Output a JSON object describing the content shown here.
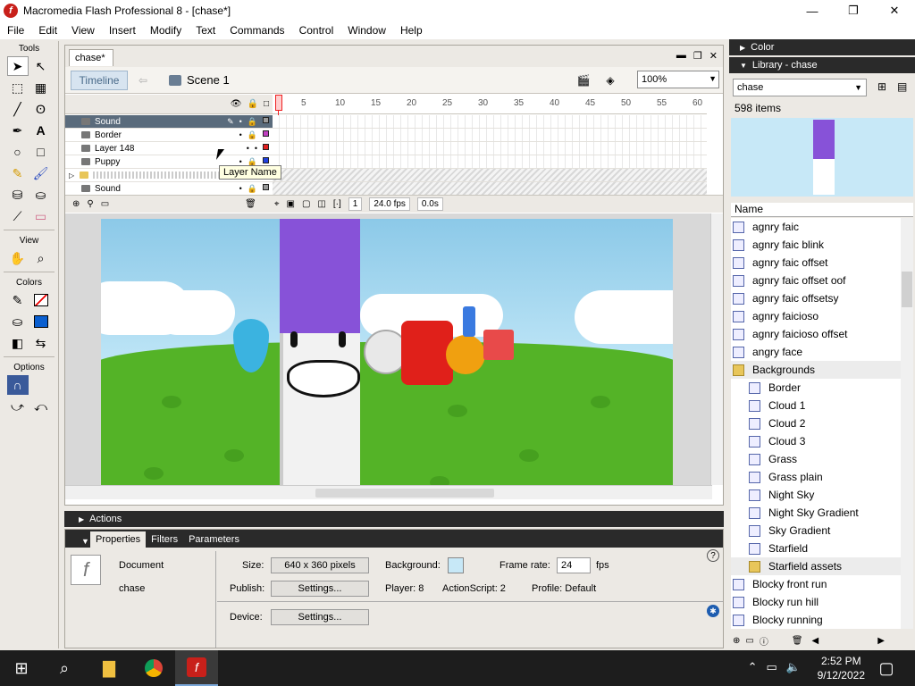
{
  "window": {
    "title": "Macromedia Flash Professional 8 - [chase*]",
    "minimize": "—",
    "maximize": "❐",
    "close": "✕"
  },
  "menu": [
    "File",
    "Edit",
    "View",
    "Insert",
    "Modify",
    "Text",
    "Commands",
    "Control",
    "Window",
    "Help"
  ],
  "tools": {
    "title": "Tools",
    "view_title": "View",
    "colors_title": "Colors",
    "options_title": "Options"
  },
  "document": {
    "tab": "chase*",
    "timeline_btn": "Timeline",
    "scene": "Scene 1",
    "zoom": "100%"
  },
  "timeline": {
    "ruler": [
      "5",
      "10",
      "15",
      "20",
      "25",
      "30",
      "35",
      "40",
      "45",
      "50",
      "55",
      "60"
    ],
    "layers": [
      {
        "name": "Sound",
        "selected": true
      },
      {
        "name": "Border",
        "selected": false
      },
      {
        "name": "Layer 148",
        "selected": false
      },
      {
        "name": "Puppy",
        "selected": false
      },
      {
        "name": "",
        "selected": false
      },
      {
        "name": "Sound",
        "selected": false
      }
    ],
    "current_frame": "1",
    "fps": "24.0 fps",
    "time": "0.0s",
    "tooltip": "Layer Name"
  },
  "actions": {
    "title": "Actions"
  },
  "properties": {
    "tabs": [
      "Properties",
      "Filters",
      "Parameters"
    ],
    "doc_label": "Document",
    "doc_name": "chase",
    "size_label": "Size:",
    "size_value": "640 x 360 pixels",
    "background_label": "Background:",
    "frame_rate_label": "Frame rate:",
    "frame_rate_value": "24",
    "fps_unit": "fps",
    "publish_label": "Publish:",
    "settings_label": "Settings...",
    "player_label": "Player: 8",
    "actionscript_label": "ActionScript:  2",
    "profile_label": "Profile:  Default",
    "device_label": "Device:",
    "device_settings": "Settings..."
  },
  "right_panels": {
    "color_title": "Color",
    "library_title": "Library - chase",
    "library_select": "chase",
    "item_count": "598 items",
    "col_name": "Name",
    "items": [
      {
        "name": "agnry faic",
        "type": "graphic",
        "indent": 0
      },
      {
        "name": "agnry faic blink",
        "type": "graphic",
        "indent": 0
      },
      {
        "name": "agnry faic offset",
        "type": "graphic",
        "indent": 0
      },
      {
        "name": "agnry faic offset oof",
        "type": "graphic",
        "indent": 0
      },
      {
        "name": "agnry faic offsetsy",
        "type": "graphic",
        "indent": 0
      },
      {
        "name": "agnry faicioso",
        "type": "graphic",
        "indent": 0
      },
      {
        "name": "agnry faicioso offset",
        "type": "graphic",
        "indent": 0
      },
      {
        "name": "angry face",
        "type": "graphic",
        "indent": 0
      },
      {
        "name": "Backgrounds",
        "type": "folder",
        "indent": 0
      },
      {
        "name": "Border",
        "type": "graphic",
        "indent": 1
      },
      {
        "name": "Cloud 1",
        "type": "graphic",
        "indent": 1
      },
      {
        "name": "Cloud 2",
        "type": "graphic",
        "indent": 1
      },
      {
        "name": "Cloud 3",
        "type": "graphic",
        "indent": 1
      },
      {
        "name": "Grass",
        "type": "graphic",
        "indent": 1
      },
      {
        "name": "Grass plain",
        "type": "graphic",
        "indent": 1
      },
      {
        "name": "Night Sky",
        "type": "graphic",
        "indent": 1
      },
      {
        "name": "Night Sky Gradient",
        "type": "graphic",
        "indent": 1
      },
      {
        "name": "Sky Gradient",
        "type": "graphic",
        "indent": 1
      },
      {
        "name": "Starfield",
        "type": "graphic",
        "indent": 1
      },
      {
        "name": "Starfield assets",
        "type": "folder",
        "indent": 1
      },
      {
        "name": "Blocky front run",
        "type": "graphic",
        "indent": 0
      },
      {
        "name": "Blocky run hill",
        "type": "graphic",
        "indent": 0
      },
      {
        "name": "Blocky running",
        "type": "graphic",
        "indent": 0
      }
    ]
  },
  "taskbar": {
    "time": "2:52 PM",
    "date": "9/12/2022"
  }
}
